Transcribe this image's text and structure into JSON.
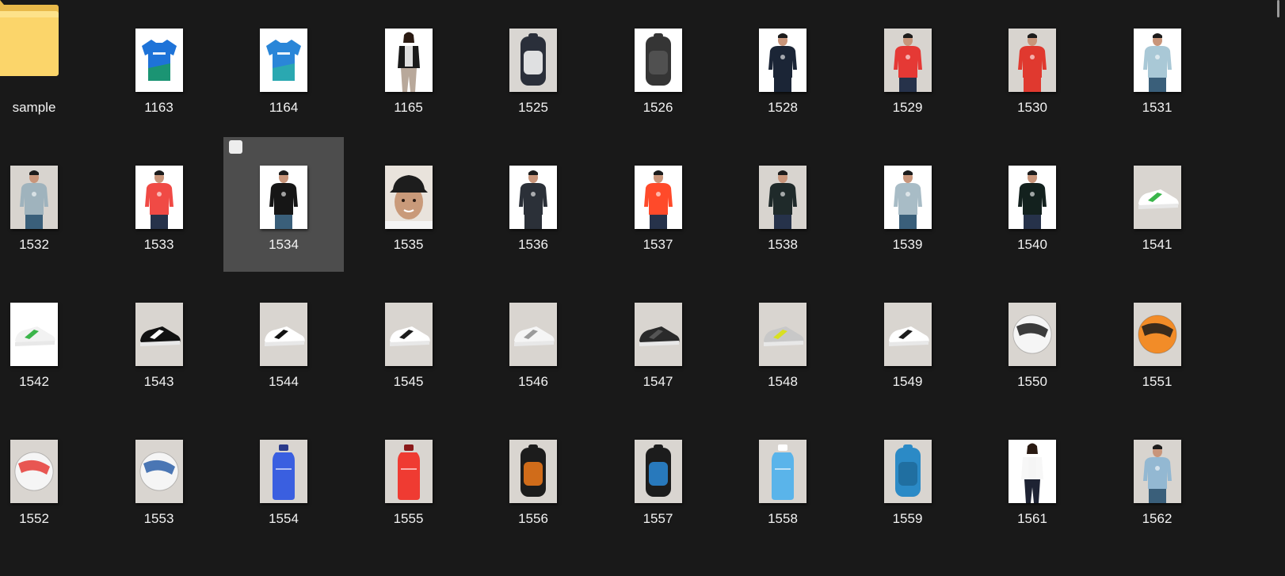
{
  "folder": {
    "label": "sample",
    "icon": "folder-icon"
  },
  "items": [
    {
      "label": "1163",
      "kind": "jersey",
      "bg": "#ffffff",
      "c": "#1e73d8",
      "c2": "#1a9c5a"
    },
    {
      "label": "1164",
      "kind": "jersey",
      "bg": "#ffffff",
      "c": "#2a86d8",
      "c2": "#2bb0a8"
    },
    {
      "label": "1165",
      "kind": "woman",
      "bg": "#ffffff",
      "c": "#1a1a1a",
      "c2": "#b8a89a"
    },
    {
      "label": "1525",
      "kind": "backpack",
      "bg": "#d9d6d2",
      "c": "#2a2f3a",
      "c2": "#ffffff"
    },
    {
      "label": "1526",
      "kind": "backpack",
      "bg": "#ffffff",
      "c": "#353535",
      "c2": "#555555"
    },
    {
      "label": "1528",
      "kind": "man",
      "bg": "#ffffff",
      "c": "#1b2536",
      "c2": "#1b2536"
    },
    {
      "label": "1529",
      "kind": "man",
      "bg": "#d8d4cf",
      "c": "#e53935",
      "c2": "#26324a"
    },
    {
      "label": "1530",
      "kind": "man",
      "bg": "#d8d4cf",
      "c": "#e0392f",
      "c2": "#e0392f"
    },
    {
      "label": "1531",
      "kind": "man",
      "bg": "#ffffff",
      "c": "#a9c8d6",
      "c2": "#3a5f7a"
    },
    {
      "label": "1532",
      "kind": "man",
      "bg": "#d8d4cf",
      "c": "#9fb3bd",
      "c2": "#3a5f7a"
    },
    {
      "label": "1533",
      "kind": "man",
      "bg": "#ffffff",
      "c": "#f04a45",
      "c2": "#26324a"
    },
    {
      "label": "1534",
      "kind": "man",
      "bg": "#ffffff",
      "c": "#161616",
      "c2": "#3a5f7a"
    },
    {
      "label": "1535",
      "kind": "face",
      "bg": "#e9e3dc",
      "c": "#1d1d1d",
      "c2": "#c99a7a"
    },
    {
      "label": "1536",
      "kind": "man",
      "bg": "#ffffff",
      "c": "#2b3038",
      "c2": "#2b3038"
    },
    {
      "label": "1537",
      "kind": "man",
      "bg": "#ffffff",
      "c": "#ff4a2a",
      "c2": "#26324a"
    },
    {
      "label": "1538",
      "kind": "man",
      "bg": "#d8d4cf",
      "c": "#1f2a2a",
      "c2": "#26324a"
    },
    {
      "label": "1539",
      "kind": "man",
      "bg": "#ffffff",
      "c": "#a8bcc6",
      "c2": "#3a5f7a"
    },
    {
      "label": "1540",
      "kind": "man",
      "bg": "#ffffff",
      "c": "#13211e",
      "c2": "#26324a"
    },
    {
      "label": "1541",
      "kind": "shoe",
      "bg": "#d9d5d0",
      "c": "#ffffff",
      "c2": "#39b54a"
    },
    {
      "label": "1542",
      "kind": "shoe",
      "bg": "#ffffff",
      "c": "#f2f2f2",
      "c2": "#3bb54a"
    },
    {
      "label": "1543",
      "kind": "shoe",
      "bg": "#d9d5d0",
      "c": "#111111",
      "c2": "#ffffff"
    },
    {
      "label": "1544",
      "kind": "shoe",
      "bg": "#d9d5d0",
      "c": "#ffffff",
      "c2": "#111111"
    },
    {
      "label": "1545",
      "kind": "shoe",
      "bg": "#d9d5d0",
      "c": "#ffffff",
      "c2": "#1c1c1c"
    },
    {
      "label": "1546",
      "kind": "shoe",
      "bg": "#d9d5d0",
      "c": "#f5f5f5",
      "c2": "#9a9a9a"
    },
    {
      "label": "1547",
      "kind": "shoe",
      "bg": "#d9d5d0",
      "c": "#2a2a2a",
      "c2": "#555555"
    },
    {
      "label": "1548",
      "kind": "shoe",
      "bg": "#d9d5d0",
      "c": "#c8c8c8",
      "c2": "#d9e021"
    },
    {
      "label": "1549",
      "kind": "shoe",
      "bg": "#d9d5d0",
      "c": "#ffffff",
      "c2": "#1c1c1c"
    },
    {
      "label": "1550",
      "kind": "ball",
      "bg": "#d9d5d0",
      "c": "#f5f5f5",
      "c2": "#1a1a1a"
    },
    {
      "label": "1551",
      "kind": "ball",
      "bg": "#d9d5d0",
      "c": "#f28c28",
      "c2": "#1a1a1a"
    },
    {
      "label": "1552",
      "kind": "ball",
      "bg": "#d9d5d0",
      "c": "#f5f5f5",
      "c2": "#e53935"
    },
    {
      "label": "1553",
      "kind": "ball",
      "bg": "#d9d5d0",
      "c": "#f5f5f5",
      "c2": "#2b5fa8"
    },
    {
      "label": "1554",
      "kind": "bottle",
      "bg": "#d9d5d0",
      "c": "#3a5fe0",
      "c2": "#2a3a8a"
    },
    {
      "label": "1555",
      "kind": "bottle",
      "bg": "#d9d5d0",
      "c": "#ef3b32",
      "c2": "#8a1a1a"
    },
    {
      "label": "1556",
      "kind": "backpack",
      "bg": "#d9d5d0",
      "c": "#1c1c1c",
      "c2": "#f07a1a"
    },
    {
      "label": "1557",
      "kind": "backpack",
      "bg": "#d9d5d0",
      "c": "#1c1c1c",
      "c2": "#2a8ad8"
    },
    {
      "label": "1558",
      "kind": "bottle",
      "bg": "#d9d5d0",
      "c": "#5ab4ea",
      "c2": "#ffffff"
    },
    {
      "label": "1559",
      "kind": "backpack",
      "bg": "#d9d5d0",
      "c": "#2b8ac6",
      "c2": "#1f6a9a"
    },
    {
      "label": "1561",
      "kind": "woman",
      "bg": "#ffffff",
      "c": "#f7f7f7",
      "c2": "#1e2333"
    },
    {
      "label": "1562",
      "kind": "man",
      "bg": "#d8d4cf",
      "c": "#93b8d2",
      "c2": "#3a5f7a"
    }
  ],
  "selected_label": "1534",
  "colors": {
    "background": "#191919",
    "selection": "#4d4d4d",
    "text": "#f2f2f2"
  }
}
